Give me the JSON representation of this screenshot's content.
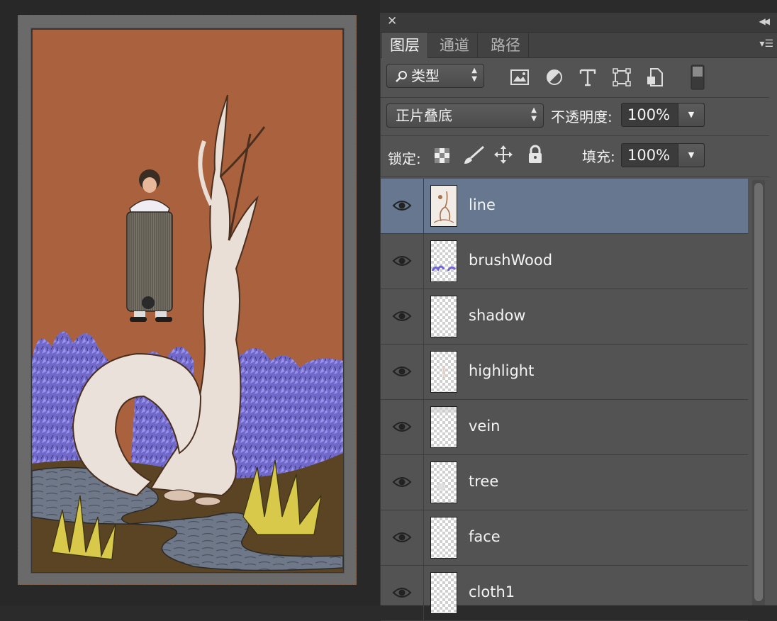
{
  "panel": {
    "tabs": [
      {
        "label": "图层",
        "active": true
      },
      {
        "label": "通道",
        "active": false
      },
      {
        "label": "路径",
        "active": false
      }
    ],
    "filter_type": "类型",
    "blend_mode": "正片叠底",
    "opacity_label": "不透明度:",
    "opacity_value": "100%",
    "lock_label": "锁定:",
    "fill_label": "填充:",
    "fill_value": "100%"
  },
  "layers": [
    {
      "name": "line",
      "selected": true
    },
    {
      "name": "brushWood",
      "selected": false
    },
    {
      "name": "shadow",
      "selected": false
    },
    {
      "name": "highlight",
      "selected": false
    },
    {
      "name": "vein",
      "selected": false
    },
    {
      "name": "tree",
      "selected": false
    },
    {
      "name": "face",
      "selected": false
    },
    {
      "name": "cloth1",
      "selected": false
    }
  ],
  "colors": {
    "selected_row": "#66778f",
    "panel_bg": "#535353",
    "art_background": "#a8603c",
    "lavender": "#7f78d6",
    "ground": "#5e4526",
    "river": "#6d7787"
  }
}
